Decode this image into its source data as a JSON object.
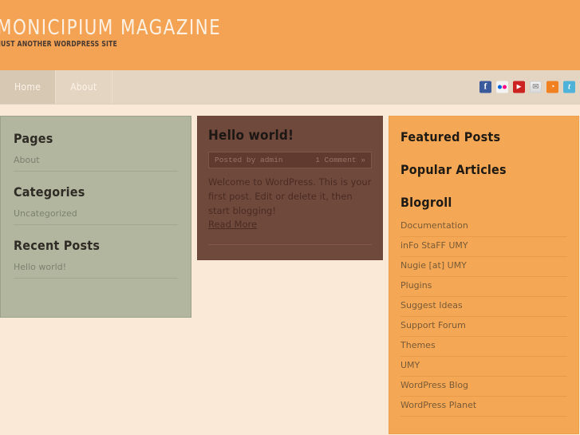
{
  "header": {
    "title": "MONICIPIUM  MAGAZINE",
    "tagline": "JUST ANOTHER WORDPRESS SITE",
    "bg_color": "#f4a355"
  },
  "nav": {
    "items": [
      {
        "label": "Home",
        "active": true
      },
      {
        "label": "About",
        "active": false
      }
    ],
    "social": [
      {
        "name": "facebook-icon",
        "glyph": "f",
        "color": "#3b5a9b"
      },
      {
        "name": "flickr-icon",
        "glyph": "",
        "color": "#f2f2f2"
      },
      {
        "name": "youtube-icon",
        "glyph": "▶",
        "color": "#cd2222"
      },
      {
        "name": "email-icon",
        "glyph": "✉",
        "color": "#e3e3e3"
      },
      {
        "name": "rss-icon",
        "glyph": "◔",
        "color": "#f08020"
      },
      {
        "name": "twitter-icon",
        "glyph": "t",
        "color": "#4fb3d9"
      }
    ]
  },
  "left_sidebar": {
    "bg_color": "#b2b69f",
    "widgets": [
      {
        "title": "Pages",
        "items": [
          "About"
        ]
      },
      {
        "title": "Categories",
        "items": [
          "Uncategorized"
        ]
      },
      {
        "title": "Recent Posts",
        "items": [
          "Hello world!"
        ]
      }
    ]
  },
  "main": {
    "bg_color": "#70493d",
    "post": {
      "title": "Hello world!",
      "author_meta": "Posted by admin",
      "comments_meta": "1 Comment »",
      "excerpt": "Welcome to WordPress. This is your first post. Edit or delete it, then start blogging!",
      "read_more": "Read More"
    }
  },
  "right_sidebar": {
    "bg_color": "#f4a855",
    "widgets": [
      {
        "title": "Featured Posts",
        "items": []
      },
      {
        "title": "Popular Articles",
        "items": []
      },
      {
        "title": "Blogroll",
        "items": [
          "Documentation",
          "inFo StaFF UMY",
          "Nugie [at] UMY",
          "Plugins",
          "Suggest Ideas",
          "Support Forum",
          "Themes",
          "UMY",
          "WordPress Blog",
          "WordPress Planet"
        ]
      }
    ]
  }
}
